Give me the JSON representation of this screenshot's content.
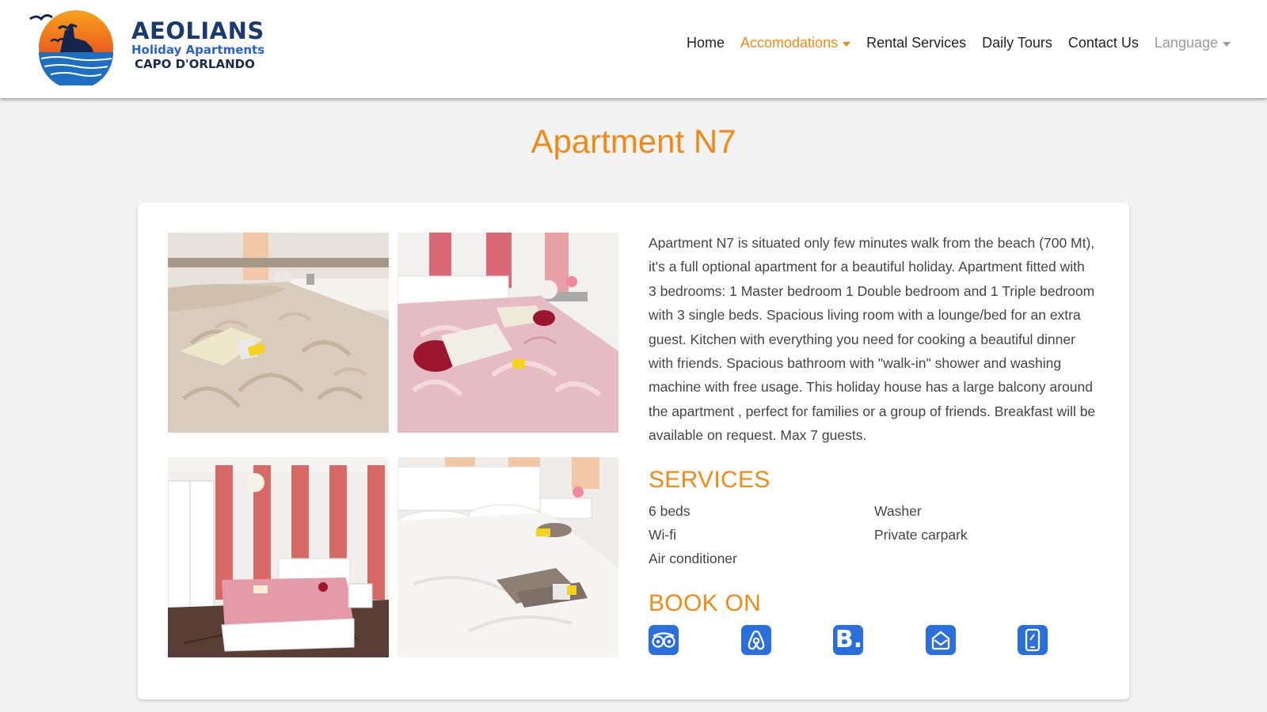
{
  "brand": {
    "name": "AEOLIANS",
    "tagline": "Holiday Apartments",
    "location": "CAPO D'ORLANDO"
  },
  "nav": {
    "items": [
      {
        "label": "Home"
      },
      {
        "label": "Accomodations"
      },
      {
        "label": "Rental Services"
      },
      {
        "label": "Daily Tours"
      },
      {
        "label": "Contact Us"
      },
      {
        "label": "Language"
      }
    ],
    "active": "Accomodations"
  },
  "page": {
    "title": "Apartment N7"
  },
  "description": "Apartment N7 is situated only few minutes walk from the beach (700 Mt), it's a full optional apartment for a beautiful holiday. Apartment fitted with 3 bedrooms: 1 Master bedroom 1 Double bedroom and 1 Triple bedroom with 3 single beds. Spacious living room with a lounge/bed for an extra guest. Kitchen with everything you need for cooking a beautiful dinner with friends. Spacious bathroom with \"walk-in\" shower and washing machine with free usage. This holiday house has a large balcony around the apartment , perfect for families or a group of friends. Breakfast will be available on request. Max 7 guests.",
  "services": {
    "title": "SERVICES",
    "items": [
      "6 beds",
      "Wi-fi",
      "Air conditioner",
      "Washer",
      "Private carpark"
    ]
  },
  "book_on": {
    "title": "BOOK ON",
    "icons": [
      "tripadvisor-icon",
      "airbnb-icon",
      "booking-icon",
      "homeaway-icon",
      "phone-icon"
    ],
    "booking_letter": "B."
  },
  "colors": {
    "accent": "#f08a17",
    "brand_blue": "#2a6fdb",
    "navy": "#1a3a72"
  }
}
